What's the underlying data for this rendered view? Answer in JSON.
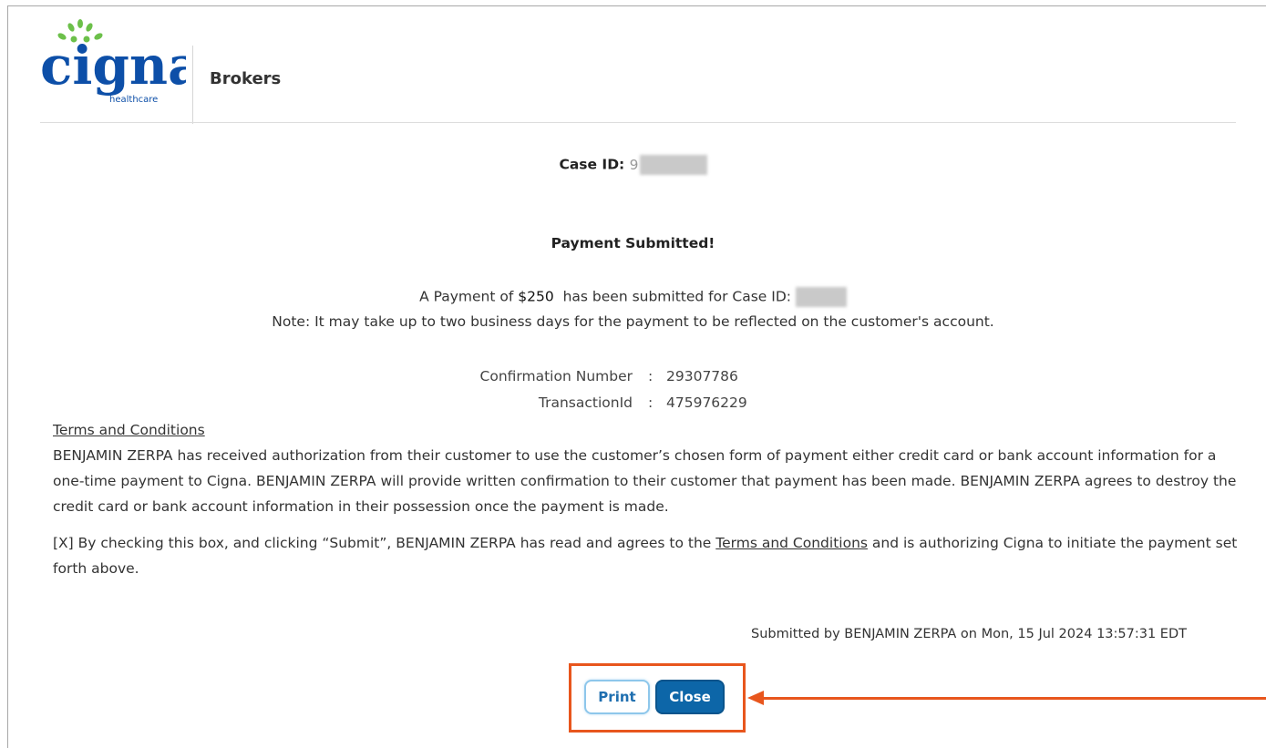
{
  "header": {
    "logo_text": "cigna",
    "logo_subtext": "healthcare",
    "title": "Brokers"
  },
  "case": {
    "label": "Case ID:",
    "value_prefix": "9"
  },
  "payment": {
    "heading": "Payment Submitted!",
    "line1_prefix": "A Payment of",
    "amount": "$250",
    "line1_suffix": "has been submitted for Case ID:",
    "note": "Note: It may take up to two business days for the payment to be reflected on the customer's account."
  },
  "confirmation": {
    "number_label": "Confirmation Number",
    "number_value": "29307786",
    "transaction_label": "TransactionId",
    "transaction_value": "475976229",
    "separator": ":"
  },
  "terms": {
    "heading": "Terms and Conditions",
    "paragraph1": "BENJAMIN ZERPA has received authorization from their customer to use the customer’s chosen form of payment either credit card or bank account information for a one-time payment to Cigna. BENJAMIN ZERPA will provide written confirmation to their customer that payment has been made. BENJAMIN ZERPA agrees to destroy the credit card or bank account information in their possession once the payment is made.",
    "paragraph2_prefix": "[X] By checking this box, and clicking “Submit”, BENJAMIN ZERPA has read and agrees to the",
    "paragraph2_link": "Terms and Conditions",
    "paragraph2_suffix": "and is authorizing Cigna to initiate the payment set forth above."
  },
  "submitted_by": "Submitted by BENJAMIN ZERPA on Mon, 15 Jul 2024 13:57:31 EDT",
  "buttons": {
    "print_label": "Print",
    "close_label": "Close"
  },
  "colors": {
    "brand_blue": "#0d4fa8",
    "brand_green": "#6cc04a",
    "button_blue": "#0d66a8",
    "annotation_orange": "#e8561d"
  }
}
